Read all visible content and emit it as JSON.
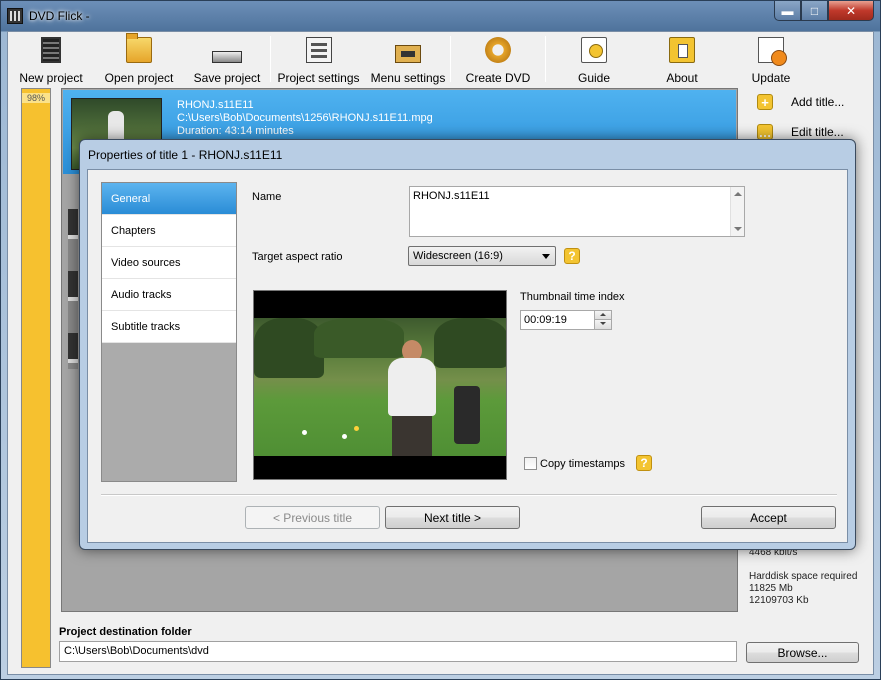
{
  "window": {
    "title": "DVD Flick -"
  },
  "toolbar": {
    "new_project": "New project",
    "open_project": "Open project",
    "save_project": "Save project",
    "project_settings": "Project settings",
    "menu_settings": "Menu settings",
    "create_dvd": "Create DVD",
    "guide": "Guide",
    "about": "About",
    "update": "Update"
  },
  "progress": {
    "label": "98%",
    "value": 98
  },
  "title_item": {
    "name": "RHONJ.s11E11",
    "path": "C:\\Users\\Bob\\Documents\\1256\\RHONJ.s11E11.mpg",
    "duration": "Duration: 43:14 minutes"
  },
  "right_panel": {
    "add_title": "Add title...",
    "edit_title": "Edit title...",
    "bitrate": "4468 kbit/s",
    "harddisk_label": "Harddisk space required",
    "harddisk_mb": "11825 Mb",
    "harddisk_kb": "12109703 Kb"
  },
  "destination": {
    "label": "Project destination folder",
    "value": "C:\\Users\\Bob\\Documents\\dvd",
    "browse": "Browse..."
  },
  "dialog": {
    "title": "Properties of title 1 - RHONJ.s11E11",
    "nav": [
      "General",
      "Chapters",
      "Video sources",
      "Audio tracks",
      "Subtitle tracks"
    ],
    "name_label": "Name",
    "name_value": "RHONJ.s11E11",
    "aspect_label": "Target aspect ratio",
    "aspect_value": "Widescreen (16:9)",
    "thumb_label": "Thumbnail time index",
    "thumb_value": "00:09:19",
    "copy_timestamps": "Copy timestamps",
    "help_glyph": "?",
    "prev_button": "< Previous title",
    "next_button": "Next title >",
    "accept_button": "Accept"
  }
}
